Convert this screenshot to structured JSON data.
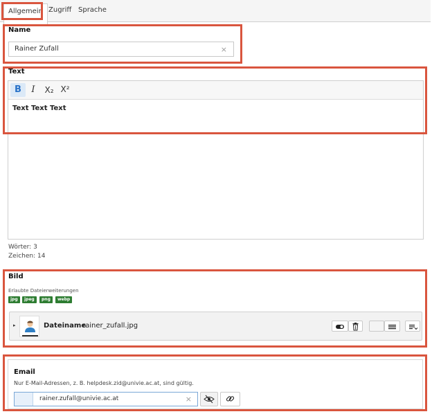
{
  "tabs": [
    {
      "label": "Allgemein"
    },
    {
      "label": "Zugriff"
    },
    {
      "label": "Sprache"
    }
  ],
  "name_field": {
    "label": "Name",
    "value": "Rainer Zufall"
  },
  "text_field": {
    "label": "Text",
    "toolbar": {
      "bold": "B",
      "italic": "I",
      "subscript": "X₂",
      "superscript": "X²"
    },
    "content": "Text Text Text",
    "word_count": "Wörter: 3",
    "char_count": "Zeichen: 14"
  },
  "image_field": {
    "label": "Bild",
    "allowed_label": "Erlaubte Dateierweiterungen",
    "extensions": [
      "jpg",
      "jpeg",
      "png",
      "webp"
    ],
    "file_label": "Dateiname",
    "file_name": "rainer_zufall.jpg"
  },
  "email_field": {
    "label": "Email",
    "hint": "Nur E-Mail-Adressen, z. B. helpdesk.zid@univie.ac.at, sind gültig.",
    "value": "rainer.zufall@univie.ac.at"
  },
  "colors": {
    "highlight": "#d9553e",
    "badge": "#2e7d32",
    "active_button": "#2a72c8"
  }
}
